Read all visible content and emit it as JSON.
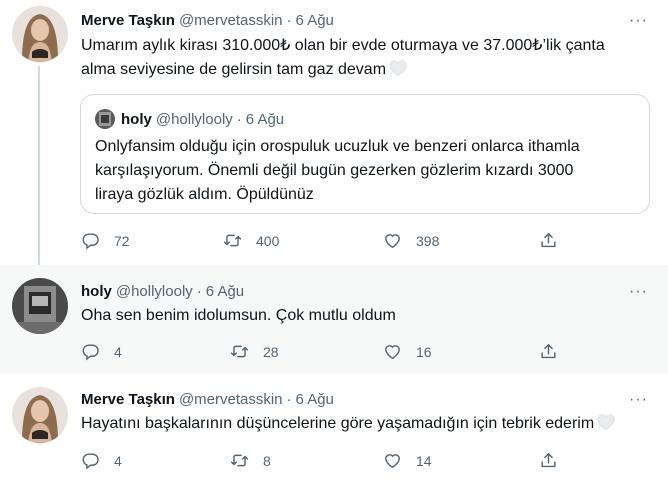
{
  "tweets": [
    {
      "name": "Merve Taşkın",
      "handle": "@mervetasskin",
      "dot": "·",
      "date": "6 Ağu",
      "text_lines": [
        "Umarım aylık kirası 310.000₺ olan bir evde oturmaya ve 37.000₺’lik çanta",
        "alma seviyesine de gelirsin tam gaz devam"
      ],
      "quote": {
        "name": "holy",
        "handle": "@hollylooly",
        "dot": "·",
        "date": "6 Ağu",
        "text_lines": [
          "Onlyfansim olduğu için orospuluk ucuzluk ve benzeri onlarca ithamla",
          "karşılaşıyorum. Önemli değil bugün gezerken gözlerim kızardı 3000",
          "liraya gözlük aldım. Öpüldünüz"
        ]
      },
      "replies": "72",
      "retweets": "400",
      "likes": "398"
    },
    {
      "name": "holy",
      "handle": "@hollylooly",
      "dot": "·",
      "date": "6 Ağu",
      "text": "Oha sen benim idolumsun. Çok mutlu oldum",
      "replies": "4",
      "retweets": "28",
      "likes": "16"
    },
    {
      "name": "Merve Taşkın",
      "handle": "@mervetasskin",
      "dot": "·",
      "date": "6 Ağu",
      "text": "Hayatını başkalarının düşüncelerine göre yaşamadığın için tebrik ederim",
      "replies": "4",
      "retweets": "8",
      "likes": "14"
    }
  ],
  "more_label": "···",
  "colors": {
    "text": "#0f1419",
    "muted": "#536471",
    "border": "#cfd9de",
    "highlight_bg": "#f7f9f9"
  },
  "icons": [
    "more-icon",
    "reply-icon",
    "retweet-icon",
    "like-icon",
    "share-icon",
    "white-heart-icon"
  ]
}
